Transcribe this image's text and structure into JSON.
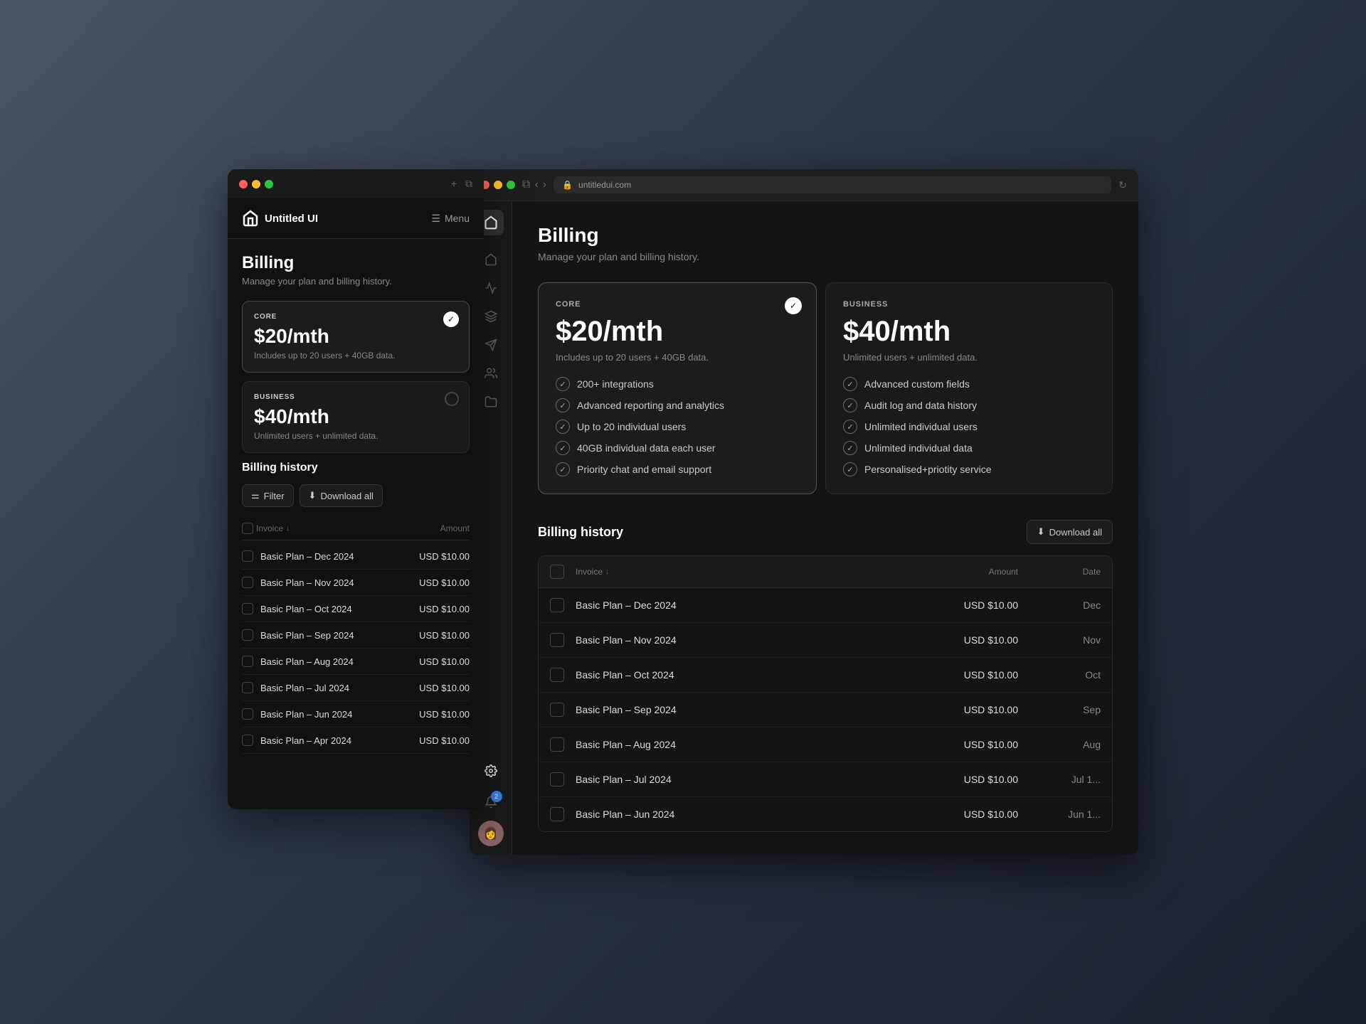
{
  "desktop": {
    "bg_color": "#5a6070"
  },
  "mobile_window": {
    "title": "Untitled UI",
    "menu_label": "Menu",
    "page_title": "Billing",
    "page_subtitle": "Manage your plan and billing history.",
    "plans": [
      {
        "id": "core",
        "badge": "CORE",
        "price": "$20/mth",
        "description": "Includes up to 20 users + 40GB data.",
        "active": true
      },
      {
        "id": "business",
        "badge": "BUSINESS",
        "price": "$40/mth",
        "description": "Unlimited users + unlimited data.",
        "active": false
      }
    ],
    "billing_history": {
      "title": "Billing history",
      "filter_label": "Filter",
      "download_label": "Download all",
      "table_headers": {
        "invoice": "Invoice",
        "amount": "Amount"
      },
      "invoices": [
        {
          "name": "Basic Plan – Dec 2024",
          "amount": "USD $10.00"
        },
        {
          "name": "Basic Plan – Nov 2024",
          "amount": "USD $10.00"
        },
        {
          "name": "Basic Plan – Oct 2024",
          "amount": "USD $10.00"
        },
        {
          "name": "Basic Plan – Sep 2024",
          "amount": "USD $10.00"
        },
        {
          "name": "Basic Plan – Aug 2024",
          "amount": "USD $10.00"
        },
        {
          "name": "Basic Plan – Jul 2024",
          "amount": "USD $10.00"
        },
        {
          "name": "Basic Plan – Jun 2024",
          "amount": "USD $10.00"
        },
        {
          "name": "Basic Plan – Apr 2024",
          "amount": "USD $10.00"
        }
      ]
    }
  },
  "browser_window": {
    "address": "untitledui.com",
    "page_title": "Billing",
    "page_subtitle": "Manage your plan and billing history.",
    "plans": [
      {
        "id": "core",
        "badge": "CORE",
        "price": "$20/mth",
        "description": "Includes up to 20 users + 40GB data.",
        "active": true,
        "features": [
          "200+ integrations",
          "Advanced reporting and analytics",
          "Up to 20 individual users",
          "40GB individual data each user",
          "Priority chat and email support"
        ]
      },
      {
        "id": "business",
        "badge": "BUSINESS",
        "price": "$40/mth",
        "description": "Unlimited users + unlimited data.",
        "active": false,
        "features": [
          "Advanced custom fields",
          "Audit log and data history",
          "Unlimited individual users",
          "Unlimited individual data",
          "Personalised+priotity service"
        ]
      }
    ],
    "billing_history": {
      "title": "Billing history",
      "download_label": "Download all",
      "table_headers": {
        "invoice": "Invoice",
        "amount": "Amount",
        "date": "Date"
      },
      "invoices": [
        {
          "name": "Basic Plan – Dec 2024",
          "amount": "USD $10.00",
          "date": "Dec"
        },
        {
          "name": "Basic Plan – Nov 2024",
          "amount": "USD $10.00",
          "date": "Nov"
        },
        {
          "name": "Basic Plan – Oct 2024",
          "amount": "USD $10.00",
          "date": "Oct"
        },
        {
          "name": "Basic Plan – Sep 2024",
          "amount": "USD $10.00",
          "date": "Sep"
        },
        {
          "name": "Basic Plan – Aug 2024",
          "amount": "USD $10.00",
          "date": "Aug"
        },
        {
          "name": "Basic Plan – Jul 2024",
          "amount": "USD $10.00",
          "date": "Jul 1..."
        },
        {
          "name": "Basic Plan – Jun 2024",
          "amount": "USD $10.00",
          "date": "Jun 1..."
        }
      ]
    },
    "sidebar": {
      "icons": [
        "home",
        "chart",
        "layers",
        "send",
        "users",
        "folder",
        "settings"
      ],
      "notification_count": "2"
    }
  }
}
